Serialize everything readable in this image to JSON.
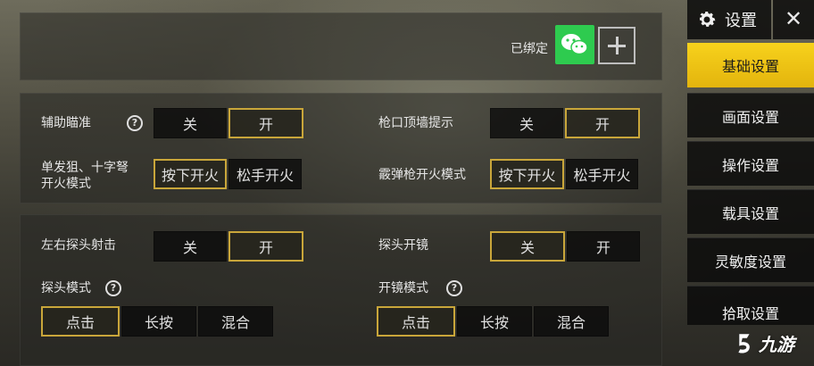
{
  "sidebar": {
    "title": "设置",
    "close": "✕",
    "items": [
      {
        "label": "基础设置",
        "active": true
      },
      {
        "label": "画面设置",
        "active": false
      },
      {
        "label": "操作设置",
        "active": false
      },
      {
        "label": "载具设置",
        "active": false
      },
      {
        "label": "灵敏度设置",
        "active": false
      },
      {
        "label": "拾取设置",
        "active": false
      }
    ]
  },
  "account": {
    "bound_label": "已绑定",
    "icons": [
      "wechat-icon",
      "plus-icon"
    ],
    "wechat_color": "#2ecb4f"
  },
  "settings": {
    "aim_assist": {
      "label": "辅助瞄准",
      "help": "?",
      "options": [
        "关",
        "开"
      ],
      "selected": "开"
    },
    "muzzle_wall_hint": {
      "label": "枪口顶墙提示",
      "options": [
        "关",
        "开"
      ],
      "selected": "开"
    },
    "sniper_crossbow_fire_mode": {
      "label_line1": "单发狙、十字弩",
      "label_line2": "开火模式",
      "options": [
        "按下开火",
        "松手开火"
      ],
      "selected": "按下开火"
    },
    "shotgun_fire_mode": {
      "label": "霰弹枪开火模式",
      "options": [
        "按下开火",
        "松手开火"
      ],
      "selected": "按下开火"
    },
    "peek_fire": {
      "label": "左右探头射击",
      "options": [
        "关",
        "开"
      ],
      "selected": "开"
    },
    "peek_scope": {
      "label": "探头开镜",
      "options": [
        "关",
        "开"
      ],
      "selected": "关"
    },
    "peek_mode": {
      "label": "探头模式",
      "help": "?",
      "options": [
        "点击",
        "长按",
        "混合"
      ],
      "selected": "点击"
    },
    "scope_mode": {
      "label": "开镜模式",
      "help": "?",
      "options": [
        "点击",
        "长按",
        "混合"
      ],
      "selected": "点击"
    }
  },
  "watermark": {
    "text": "九游"
  },
  "colors": {
    "accent": "#f7d21c",
    "selected_border": "#c9a63a"
  }
}
